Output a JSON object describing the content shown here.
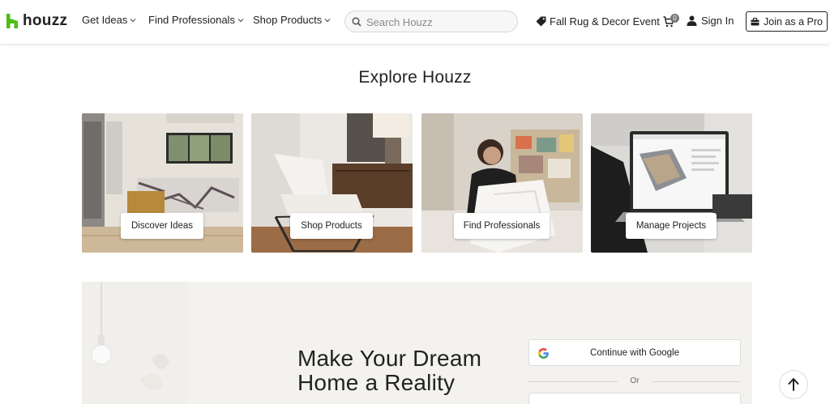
{
  "header": {
    "logo_text": "houzz",
    "nav": [
      {
        "label": "Get Ideas"
      },
      {
        "label": "Find Professionals"
      },
      {
        "label": "Shop Products"
      }
    ],
    "search_placeholder": "Search Houzz",
    "promo_label": "Fall Rug & Decor Event",
    "cart_count": "0",
    "signin_label": "Sign In",
    "join_label": "Join as a Pro"
  },
  "explore": {
    "title": "Explore Houzz",
    "tiles": [
      {
        "label": "Discover Ideas"
      },
      {
        "label": "Shop Products"
      },
      {
        "label": "Find Professionals"
      },
      {
        "label": "Manage Projects"
      }
    ]
  },
  "signup": {
    "headline_line1": "Make Your Dream",
    "headline_line2": "Home a Reality",
    "google_label": "Continue with Google",
    "or_label": "Or"
  },
  "colors": {
    "brand_green": "#4dbc15",
    "band_bg": "#f3f2ef"
  },
  "icons": [
    "houzz-logo-icon",
    "chevron-down-icon",
    "search-icon",
    "tag-icon",
    "cart-icon",
    "user-icon",
    "briefcase-icon",
    "google-icon",
    "arrow-up-icon"
  ]
}
